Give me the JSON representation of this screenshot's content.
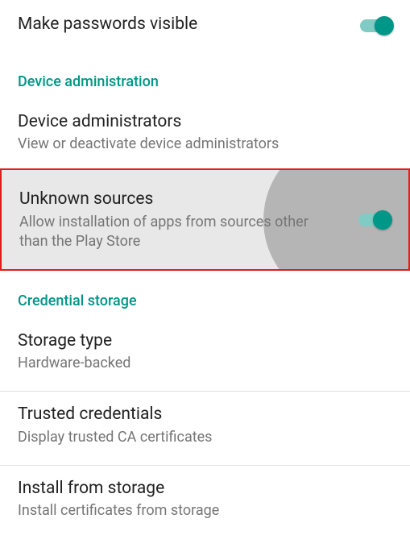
{
  "colors": {
    "accent": "#009688",
    "accentTrack": "#80cbc4",
    "highlight": "#e21b1b"
  },
  "rows": {
    "passwords": {
      "title": "Make passwords visible",
      "toggle": true
    },
    "section_admin": "Device administration",
    "admins": {
      "title": "Device administrators",
      "subtitle": "View or deactivate device administrators"
    },
    "unknown": {
      "title": "Unknown sources",
      "subtitle": "Allow installation of apps from sources other than the Play Store",
      "toggle": true,
      "highlighted": true
    },
    "section_cred": "Credential storage",
    "storage_type": {
      "title": "Storage type",
      "subtitle": "Hardware-backed"
    },
    "trusted": {
      "title": "Trusted credentials",
      "subtitle": "Display trusted CA certificates"
    },
    "install": {
      "title": "Install from storage",
      "subtitle": "Install certificates from storage"
    }
  }
}
